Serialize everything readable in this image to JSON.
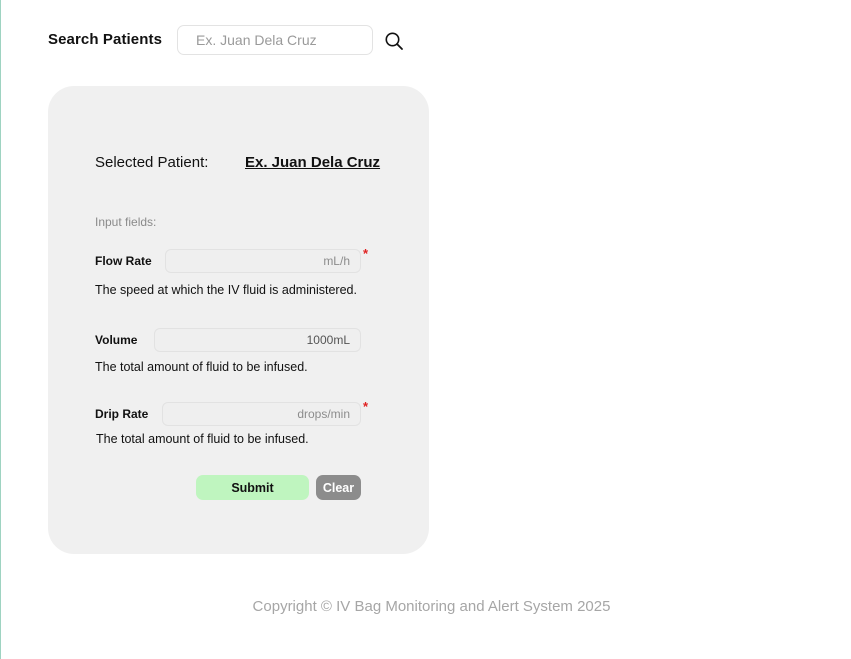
{
  "search": {
    "label": "Search Patients",
    "placeholder": "Ex. Juan Dela Cruz",
    "icon": "search-icon"
  },
  "patient": {
    "selected_label": "Selected Patient:",
    "selected_name": "Ex. Juan Dela Cruz"
  },
  "form": {
    "section_label": "Input fields:",
    "required_marker": "*",
    "flow_rate": {
      "label": "Flow Rate",
      "placeholder": "mL/h",
      "required": true,
      "help": "The speed at which the IV fluid is administered."
    },
    "volume": {
      "label": "Volume",
      "value": "1000mL",
      "required": false,
      "help": "The total amount of fluid to be infused."
    },
    "drip_rate": {
      "label": "Drip Rate",
      "placeholder": "drops/min",
      "required": true,
      "help": "The total amount of fluid to be infused."
    },
    "submit_label": "Submit",
    "clear_label": "Clear"
  },
  "footer": {
    "copyright": "Copyright © IV Bag Monitoring and Alert System 2025"
  },
  "colors": {
    "card_bg": "#f0f0f0",
    "submit_bg": "#bff5bf",
    "clear_bg": "#8c8c8c",
    "required": "#e02020",
    "footer_text": "#a6a6a6"
  }
}
